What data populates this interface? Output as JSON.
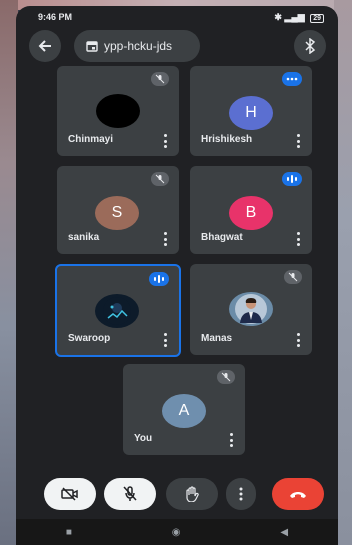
{
  "status": {
    "time": "9:46 PM",
    "battery": "29"
  },
  "header": {
    "meeting_code": "ypp-hcku-jds"
  },
  "participants": [
    {
      "name": "Chinmayi",
      "avatar_letter": "",
      "avatar_color": "#000000",
      "state": "muted"
    },
    {
      "name": "Hrishikesh",
      "avatar_letter": "H",
      "avatar_color": "#5b6fd1",
      "state": "speaking"
    },
    {
      "name": "sanika",
      "avatar_letter": "S",
      "avatar_color": "#9b6b5a",
      "state": "muted"
    },
    {
      "name": "Bhagwat",
      "avatar_letter": "B",
      "avatar_color": "#e8336a",
      "state": "speaking"
    },
    {
      "name": "Swaroop",
      "avatar_letter": "",
      "avatar_color": "#0d1b2a",
      "state": "speaking"
    },
    {
      "name": "Manas",
      "avatar_letter": "",
      "avatar_color": "#6b8ca8",
      "state": "muted"
    },
    {
      "name": "You",
      "avatar_letter": "A",
      "avatar_color": "#6f8fae",
      "state": "muted"
    }
  ],
  "colors": {
    "accent": "#1a73e8",
    "end_call": "#ea4335",
    "tile": "#3c4043"
  }
}
